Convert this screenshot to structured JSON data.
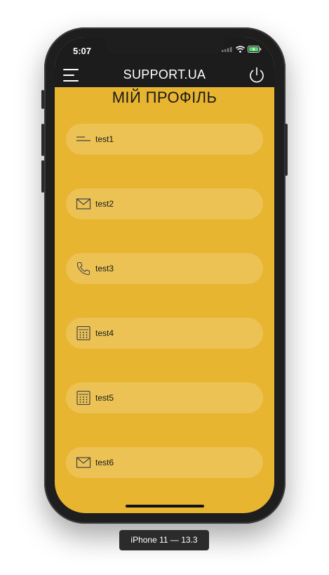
{
  "status_bar": {
    "time": "5:07",
    "icons": [
      "signal-icon",
      "wifi-icon",
      "battery-charging-icon"
    ]
  },
  "nav": {
    "title": "SUPPORT.UA",
    "menu_icon": "hamburger-menu-icon",
    "power_icon": "power-icon"
  },
  "page": {
    "title": "МІЙ ПРОФІЛЬ"
  },
  "items": [
    {
      "icon": "lines-icon",
      "label": "test1"
    },
    {
      "icon": "envelope-icon",
      "label": "test2"
    },
    {
      "icon": "phone-icon",
      "label": "test3"
    },
    {
      "icon": "calculator-icon",
      "label": "test4"
    },
    {
      "icon": "calculator-icon",
      "label": "test5"
    },
    {
      "icon": "envelope-icon",
      "label": "test6"
    }
  ],
  "device_label": "iPhone 11 — 13.3",
  "colors": {
    "accent": "#e8b530",
    "bar": "#1c1c1c",
    "item_bg": "rgba(255,255,255,0.18)"
  }
}
